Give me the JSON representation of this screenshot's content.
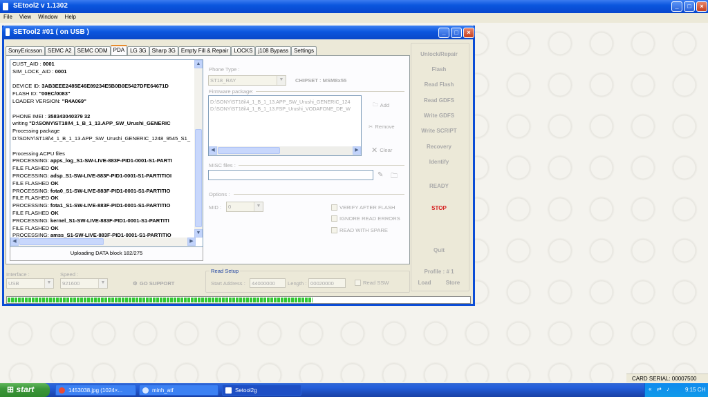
{
  "outer_window": {
    "title": "SEtool2 v 1.1302",
    "minimize": "_",
    "maximize": "□",
    "close": "×"
  },
  "menu": [
    "File",
    "View",
    "Window",
    "Help"
  ],
  "inner_window": {
    "title": "SETool2 #01 ( on USB )",
    "minimize": "_",
    "maximize": "□",
    "close": "×"
  },
  "tabs": [
    "SonyEricsson",
    "SEMC A2",
    "SEMC ODM",
    "PDA",
    "LG 3G",
    "Sharp 3G",
    "Empty Fill & Repair",
    "LOCKS",
    "j108 Bypass",
    "Settings"
  ],
  "active_tab": "PDA",
  "log": {
    "lines": [
      {
        "k": "CUST_AID : ",
        "v": "0001"
      },
      {
        "k": "SIM_LOCK_AID : ",
        "v": "0001"
      },
      {
        "k": "",
        "v": ""
      },
      {
        "k": "DEVICE ID: ",
        "v": "3AB3EEE2485E46E89234E5B0B0E5427DFE64671D"
      },
      {
        "k": "FLASH ID: ",
        "v": "\"00EC/0083\""
      },
      {
        "k": "LOADER VERSION: ",
        "v": "\"R4A069\""
      },
      {
        "k": "",
        "v": ""
      },
      {
        "k": "PHONE IMEI : ",
        "v": "358343040379 32"
      },
      {
        "k": "writing ",
        "v": "\"D:\\SONY\\ST18i\\4_1_B_1_13.APP_SW_Urushi_GENERIC"
      },
      {
        "k": "Processing package",
        "v": ""
      },
      {
        "k": "D:\\SONY\\ST18i\\4_1_B_1_13.APP_SW_Urushi_GENERIC_1248_9545_S1_",
        "v": ""
      },
      {
        "k": "",
        "v": ""
      },
      {
        "k": "Processing ACPU files",
        "v": ""
      },
      {
        "k": "PROCESSING: ",
        "v": "apps_log_S1-SW-LIVE-883F-PID1-0001-S1-PARTI"
      },
      {
        "k": "FILE FLASHED ",
        "v": "OK"
      },
      {
        "k": "PROCESSING: ",
        "v": "adsp_S1-SW-LIVE-883F-PID1-0001-S1-PARTITIOI"
      },
      {
        "k": "FILE FLASHED ",
        "v": "OK"
      },
      {
        "k": "PROCESSING: ",
        "v": "fota0_S1-SW-LIVE-883F-PID1-0001-S1-PARTITIO"
      },
      {
        "k": "FILE FLASHED ",
        "v": "OK"
      },
      {
        "k": "PROCESSING: ",
        "v": "fota1_S1-SW-LIVE-883F-PID1-0001-S1-PARTITIO"
      },
      {
        "k": "FILE FLASHED ",
        "v": "OK"
      },
      {
        "k": "PROCESSING: ",
        "v": "kernel_S1-SW-LIVE-883F-PID1-0001-S1-PARTITI"
      },
      {
        "k": "FILE FLASHED ",
        "v": "OK"
      },
      {
        "k": "PROCESSING: ",
        "v": "amss_S1-SW-LIVE-883F-PID1-0001-S1-PARTITIO"
      }
    ],
    "status": "Uploading DATA block 182/275"
  },
  "phone_type": {
    "label": "Phone Type :",
    "value": "ST18_RAY",
    "chipset": "CHIPSET : MSM8x55"
  },
  "firmware": {
    "label": "Firmware package:",
    "files": [
      "D:\\SONY\\ST18i\\4_1_B_1_13.APP_SW_Urushi_GENERIC_124",
      "D:\\SONY\\ST18i\\4_1_B_1_13.FSP_Urushi_VODAFONE_DE_W"
    ],
    "add": "Add",
    "remove": "Remove",
    "clear": "Clear"
  },
  "misc": {
    "label": "MISC files :"
  },
  "options": {
    "label": "Options :",
    "mid_label": "MID :",
    "mid_value": "0",
    "verify": "VERIFY AFTER FLASH",
    "ignore": "IGNORE READ ERRORS",
    "spare": "READ WITH SPARE"
  },
  "right_buttons": {
    "unlock": "Unlock/Repair",
    "flash": "Flash",
    "read_flash": "Read Flash",
    "read_gdfs": "Read GDFS",
    "write_gdfs": "Write GDFS",
    "write_script": "Write SCRIPT",
    "recovery": "Recovery",
    "identify": "Identify",
    "ready": "READY",
    "stop": "STOP",
    "quit": "Quit",
    "profile": "Profile : # 1",
    "load": "Load",
    "store": "Store"
  },
  "bottom": {
    "interface_label": "Interface :",
    "interface_value": "USB",
    "speed_label": "Speed :",
    "speed_value": "921600",
    "go_support": "GO SUPPORT",
    "read_setup": "Read Setup",
    "start_label": "Start Address :",
    "start_value": "44000000",
    "length_label": "Length :",
    "length_value": "00020000",
    "read_ssw": "Read SSW"
  },
  "progress": 0.66,
  "colors": {
    "stop": "#d62020",
    "green": "#32c832"
  },
  "card_serial": "CARD SERIAL: 00007500",
  "taskbar": {
    "start": "start",
    "tasks": [
      "1453038.jpg (1024×...",
      "minh_atf",
      "Setool2g"
    ],
    "time": "9:15 CH"
  }
}
